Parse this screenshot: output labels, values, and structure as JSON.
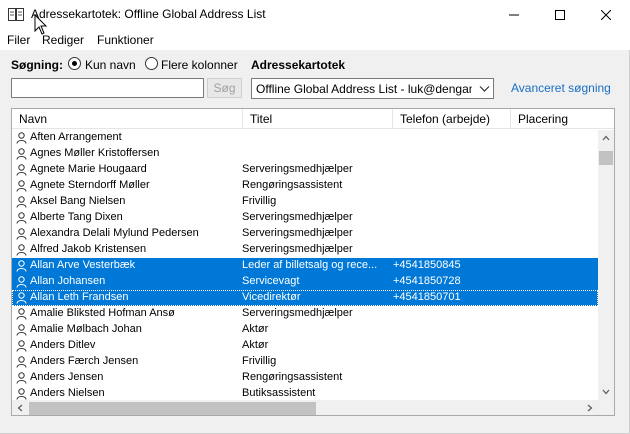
{
  "window": {
    "title": "Adressekartotek: Offline Global Address List"
  },
  "menu": {
    "items": [
      "Filer",
      "Rediger",
      "Funktioner"
    ]
  },
  "search": {
    "label": "Søgning:",
    "option_name_only": "Kun navn",
    "option_more_columns": "Flere kolonner",
    "selected_option": "Kun navn",
    "input_value": "",
    "button_label": "Søg"
  },
  "address_book": {
    "label": "Adressekartotek",
    "selected": "Offline Global Address List - luk@dengaml",
    "advanced_link": "Avanceret søgning"
  },
  "list": {
    "columns": [
      "Navn",
      "Titel",
      "Telefon (arbejde)",
      "Placering"
    ],
    "rows": [
      {
        "name": "Aften Arrangement",
        "title": "",
        "phone": "",
        "selected": false
      },
      {
        "name": "Agnes Møller Kristoffersen",
        "title": "",
        "phone": "",
        "selected": false
      },
      {
        "name": "Agnete Marie Hougaard",
        "title": "Serveringsmedhjælper",
        "phone": "",
        "selected": false
      },
      {
        "name": "Agnete Sterndorff Møller",
        "title": "Rengøringsassistent",
        "phone": "",
        "selected": false
      },
      {
        "name": "Aksel Bang Nielsen",
        "title": "Frivillig",
        "phone": "",
        "selected": false
      },
      {
        "name": "Alberte Tang Dixen",
        "title": "Serveringsmedhjælper",
        "phone": "",
        "selected": false
      },
      {
        "name": "Alexandra Delali Mylund Pedersen",
        "title": "Serveringsmedhjælper",
        "phone": "",
        "selected": false
      },
      {
        "name": "Alfred Jakob Kristensen",
        "title": "Serveringsmedhjælper",
        "phone": "",
        "selected": false
      },
      {
        "name": "Allan Arve Vesterbæk",
        "title": "Leder af billetsalg og rece...",
        "phone": "+4541850845",
        "selected": true
      },
      {
        "name": "Allan Johansen",
        "title": "Servicevagt",
        "phone": "+4541850728",
        "selected": true
      },
      {
        "name": "Allan Leth Frandsen",
        "title": "Vicedirektør",
        "phone": "+4541850701",
        "selected": true
      },
      {
        "name": "Amalie Bliksted Hofman Ansø",
        "title": "Serveringsmedhjælper",
        "phone": "",
        "selected": false
      },
      {
        "name": "Amalie Mølbach Johan",
        "title": "Aktør",
        "phone": "",
        "selected": false
      },
      {
        "name": "Anders Ditlev",
        "title": "Aktør",
        "phone": "",
        "selected": false
      },
      {
        "name": "Anders Færch Jensen",
        "title": "Frivillig",
        "phone": "",
        "selected": false
      },
      {
        "name": "Anders Jensen",
        "title": "Rengøringsassistent",
        "phone": "",
        "selected": false
      },
      {
        "name": "Anders Nielsen",
        "title": "Butiksassistent",
        "phone": "",
        "selected": false
      }
    ]
  },
  "colors": {
    "selection": "#0078d7",
    "link": "#1a6fc4"
  }
}
